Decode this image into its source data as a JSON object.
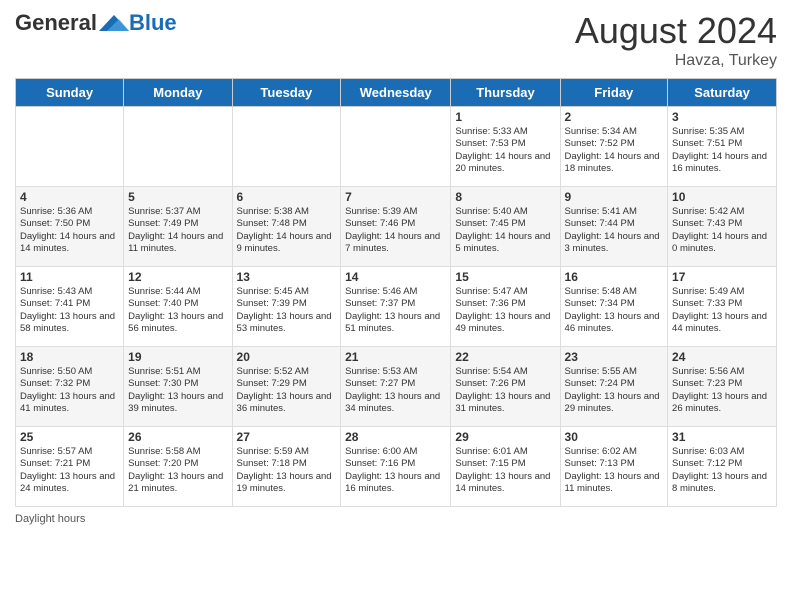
{
  "logo": {
    "general": "General",
    "blue": "Blue"
  },
  "header": {
    "month_year": "August 2024",
    "location": "Havza, Turkey"
  },
  "days_of_week": [
    "Sunday",
    "Monday",
    "Tuesday",
    "Wednesday",
    "Thursday",
    "Friday",
    "Saturday"
  ],
  "footer": {
    "daylight_hours": "Daylight hours"
  },
  "weeks": [
    [
      {
        "day": "",
        "info": ""
      },
      {
        "day": "",
        "info": ""
      },
      {
        "day": "",
        "info": ""
      },
      {
        "day": "",
        "info": ""
      },
      {
        "day": "1",
        "info": "Sunrise: 5:33 AM\nSunset: 7:53 PM\nDaylight: 14 hours and 20 minutes."
      },
      {
        "day": "2",
        "info": "Sunrise: 5:34 AM\nSunset: 7:52 PM\nDaylight: 14 hours and 18 minutes."
      },
      {
        "day": "3",
        "info": "Sunrise: 5:35 AM\nSunset: 7:51 PM\nDaylight: 14 hours and 16 minutes."
      }
    ],
    [
      {
        "day": "4",
        "info": "Sunrise: 5:36 AM\nSunset: 7:50 PM\nDaylight: 14 hours and 14 minutes."
      },
      {
        "day": "5",
        "info": "Sunrise: 5:37 AM\nSunset: 7:49 PM\nDaylight: 14 hours and 11 minutes."
      },
      {
        "day": "6",
        "info": "Sunrise: 5:38 AM\nSunset: 7:48 PM\nDaylight: 14 hours and 9 minutes."
      },
      {
        "day": "7",
        "info": "Sunrise: 5:39 AM\nSunset: 7:46 PM\nDaylight: 14 hours and 7 minutes."
      },
      {
        "day": "8",
        "info": "Sunrise: 5:40 AM\nSunset: 7:45 PM\nDaylight: 14 hours and 5 minutes."
      },
      {
        "day": "9",
        "info": "Sunrise: 5:41 AM\nSunset: 7:44 PM\nDaylight: 14 hours and 3 minutes."
      },
      {
        "day": "10",
        "info": "Sunrise: 5:42 AM\nSunset: 7:43 PM\nDaylight: 14 hours and 0 minutes."
      }
    ],
    [
      {
        "day": "11",
        "info": "Sunrise: 5:43 AM\nSunset: 7:41 PM\nDaylight: 13 hours and 58 minutes."
      },
      {
        "day": "12",
        "info": "Sunrise: 5:44 AM\nSunset: 7:40 PM\nDaylight: 13 hours and 56 minutes."
      },
      {
        "day": "13",
        "info": "Sunrise: 5:45 AM\nSunset: 7:39 PM\nDaylight: 13 hours and 53 minutes."
      },
      {
        "day": "14",
        "info": "Sunrise: 5:46 AM\nSunset: 7:37 PM\nDaylight: 13 hours and 51 minutes."
      },
      {
        "day": "15",
        "info": "Sunrise: 5:47 AM\nSunset: 7:36 PM\nDaylight: 13 hours and 49 minutes."
      },
      {
        "day": "16",
        "info": "Sunrise: 5:48 AM\nSunset: 7:34 PM\nDaylight: 13 hours and 46 minutes."
      },
      {
        "day": "17",
        "info": "Sunrise: 5:49 AM\nSunset: 7:33 PM\nDaylight: 13 hours and 44 minutes."
      }
    ],
    [
      {
        "day": "18",
        "info": "Sunrise: 5:50 AM\nSunset: 7:32 PM\nDaylight: 13 hours and 41 minutes."
      },
      {
        "day": "19",
        "info": "Sunrise: 5:51 AM\nSunset: 7:30 PM\nDaylight: 13 hours and 39 minutes."
      },
      {
        "day": "20",
        "info": "Sunrise: 5:52 AM\nSunset: 7:29 PM\nDaylight: 13 hours and 36 minutes."
      },
      {
        "day": "21",
        "info": "Sunrise: 5:53 AM\nSunset: 7:27 PM\nDaylight: 13 hours and 34 minutes."
      },
      {
        "day": "22",
        "info": "Sunrise: 5:54 AM\nSunset: 7:26 PM\nDaylight: 13 hours and 31 minutes."
      },
      {
        "day": "23",
        "info": "Sunrise: 5:55 AM\nSunset: 7:24 PM\nDaylight: 13 hours and 29 minutes."
      },
      {
        "day": "24",
        "info": "Sunrise: 5:56 AM\nSunset: 7:23 PM\nDaylight: 13 hours and 26 minutes."
      }
    ],
    [
      {
        "day": "25",
        "info": "Sunrise: 5:57 AM\nSunset: 7:21 PM\nDaylight: 13 hours and 24 minutes."
      },
      {
        "day": "26",
        "info": "Sunrise: 5:58 AM\nSunset: 7:20 PM\nDaylight: 13 hours and 21 minutes."
      },
      {
        "day": "27",
        "info": "Sunrise: 5:59 AM\nSunset: 7:18 PM\nDaylight: 13 hours and 19 minutes."
      },
      {
        "day": "28",
        "info": "Sunrise: 6:00 AM\nSunset: 7:16 PM\nDaylight: 13 hours and 16 minutes."
      },
      {
        "day": "29",
        "info": "Sunrise: 6:01 AM\nSunset: 7:15 PM\nDaylight: 13 hours and 14 minutes."
      },
      {
        "day": "30",
        "info": "Sunrise: 6:02 AM\nSunset: 7:13 PM\nDaylight: 13 hours and 11 minutes."
      },
      {
        "day": "31",
        "info": "Sunrise: 6:03 AM\nSunset: 7:12 PM\nDaylight: 13 hours and 8 minutes."
      }
    ]
  ]
}
